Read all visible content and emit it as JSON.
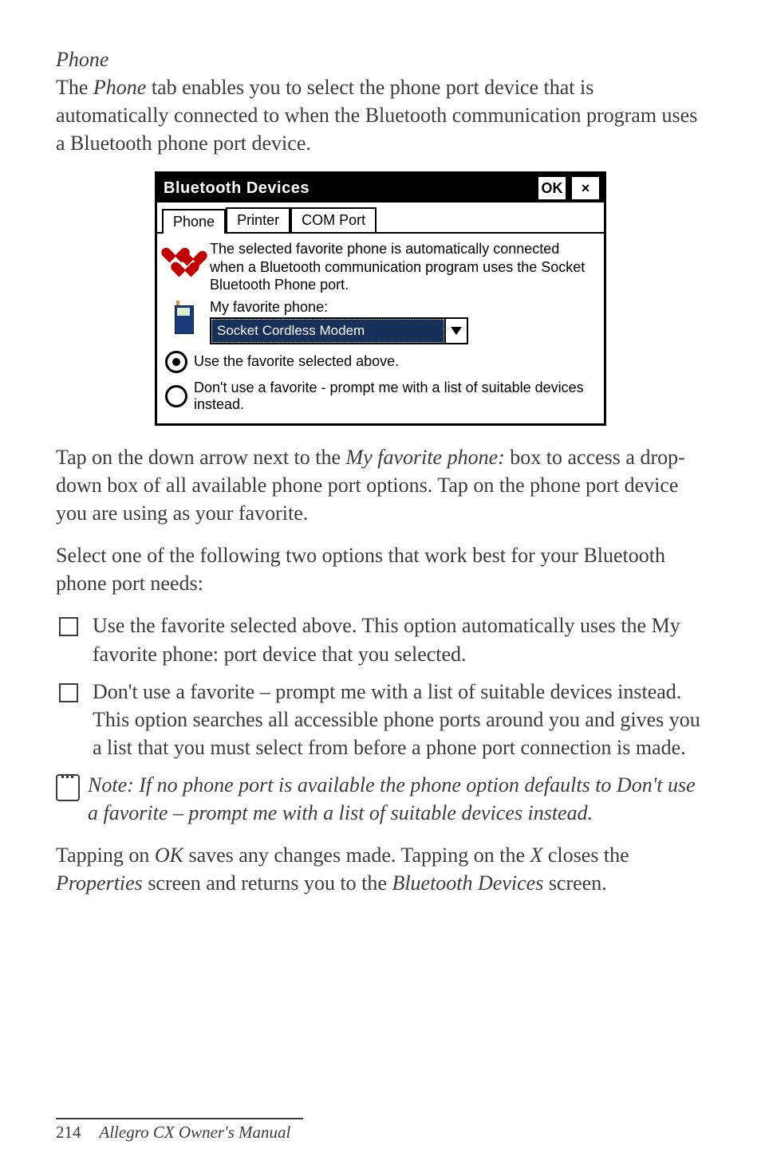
{
  "section_heading": "Phone",
  "intro": {
    "prefix": "The ",
    "em": "Phone",
    "suffix": " tab enables you to select the phone port device that is automatically connected to when the Bluetooth communication program uses a Bluetooth phone port device."
  },
  "dialog": {
    "title": "Bluetooth Devices",
    "ok": "OK",
    "close": "×",
    "tabs": {
      "phone": "Phone",
      "printer": "Printer",
      "com": "COM Port"
    },
    "description": "The selected favorite phone is automatically connected when a Bluetooth communication program uses the Socket Bluetooth Phone port.",
    "fav_label": "My favorite phone:",
    "fav_value": "Socket Cordless Modem",
    "radio_use": "Use the favorite selected above.",
    "radio_dont": "Don't use a favorite - prompt me with a list of suitable devices instead."
  },
  "para_tap": {
    "t1": "Tap on the down arrow next to the ",
    "em1": "My favorite phone:",
    "t2": " box to access a drop-down box of all available phone port options. Tap on the phone port device you are using as your favorite."
  },
  "para_select": "Select one of the following two options that work best for your Bluetooth phone port needs:",
  "options": [
    "Use the favorite selected above. This option automatically uses the My favorite phone: port device that you selected.",
    "Don't use a favorite – prompt me with a list of suitable devices instead. This option searches all accessible phone ports around you and gives you a list that you must select from before a phone port connection is made."
  ],
  "note": "Note: If no phone port is available the phone option defaults to Don't use a favorite – prompt me with a list of suitable devices instead.",
  "para_ok": {
    "t1": "Tapping on ",
    "em1": "OK",
    "t2": " saves any changes made. Tapping on the ",
    "em2": "X",
    "t3": " closes the ",
    "em3": "Properties",
    "t4": " screen and returns you to the ",
    "em4": "Bluetooth Devices",
    "t5": " screen."
  },
  "footer": {
    "page": "214",
    "title": "Allegro CX Owner's Manual"
  }
}
